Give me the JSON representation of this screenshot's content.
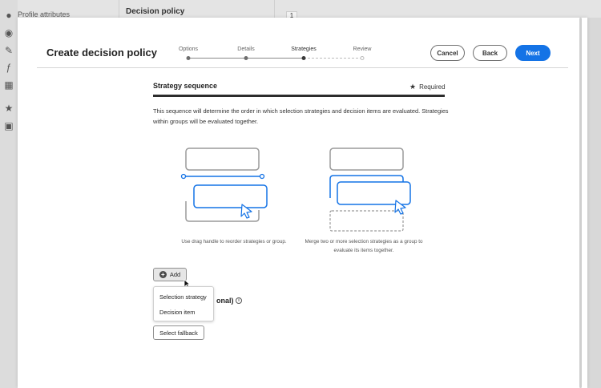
{
  "background": {
    "profile_attributes": "Profile attributes",
    "decision_policy": "Decision policy",
    "cell_number": "1"
  },
  "modal": {
    "title": "Create decision policy",
    "steps": [
      {
        "label": "Options",
        "status": "completed"
      },
      {
        "label": "Details",
        "status": "completed"
      },
      {
        "label": "Strategies",
        "status": "current"
      },
      {
        "label": "Review",
        "status": "upcoming"
      }
    ],
    "buttons": {
      "cancel": "Cancel",
      "back": "Back",
      "next": "Next"
    }
  },
  "strategy": {
    "title": "Strategy sequence",
    "required_label": "Required",
    "description": "This sequence will determine the order in which selection strategies and decision items are evaluated. Strategies within groups will be evaluated together.",
    "caption_reorder": "Use drag handle to reorder strategies or group.",
    "caption_merge": "Merge two or more selection strategies as a group to evaluate its items together.",
    "add_label": "Add",
    "menu": [
      "Selection strategy",
      "Decision item"
    ]
  },
  "fallback": {
    "title_partial": "onal)",
    "button": "Select fallback"
  },
  "colors": {
    "accent": "#1473e6",
    "illustration_blue": "#1473e6",
    "illustration_gray": "#9a9a9a"
  }
}
